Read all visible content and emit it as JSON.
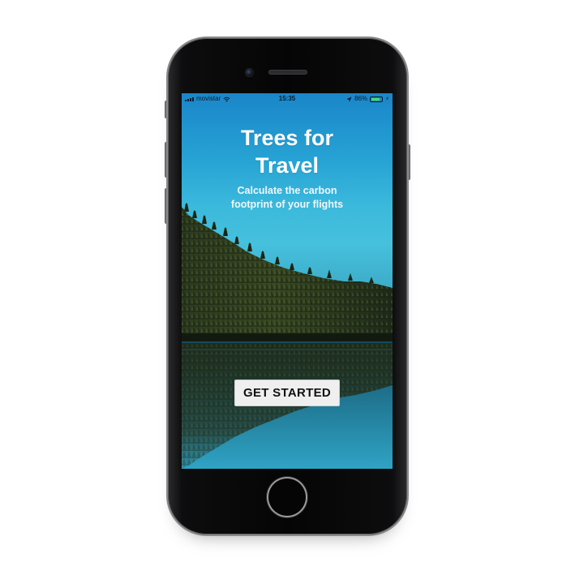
{
  "status_bar": {
    "carrier": "movistar",
    "time": "15:35",
    "battery_percent": "86%",
    "battery_level": 0.86,
    "icons": [
      "signal-icon",
      "wifi-icon",
      "location-icon",
      "battery-icon",
      "charge-icon"
    ]
  },
  "app": {
    "title": "Trees for\nTravel",
    "subtitle": "Calculate the carbon\nfootprint of your flights",
    "cta_label": "GET STARTED"
  },
  "colors": {
    "sky_top": "#1a86c9",
    "sky_mid": "#46c0dd",
    "forest": "#1e2a1a",
    "lake": "#1c6b86",
    "button_bg": "#efefef",
    "battery_green": "#4cd964"
  }
}
